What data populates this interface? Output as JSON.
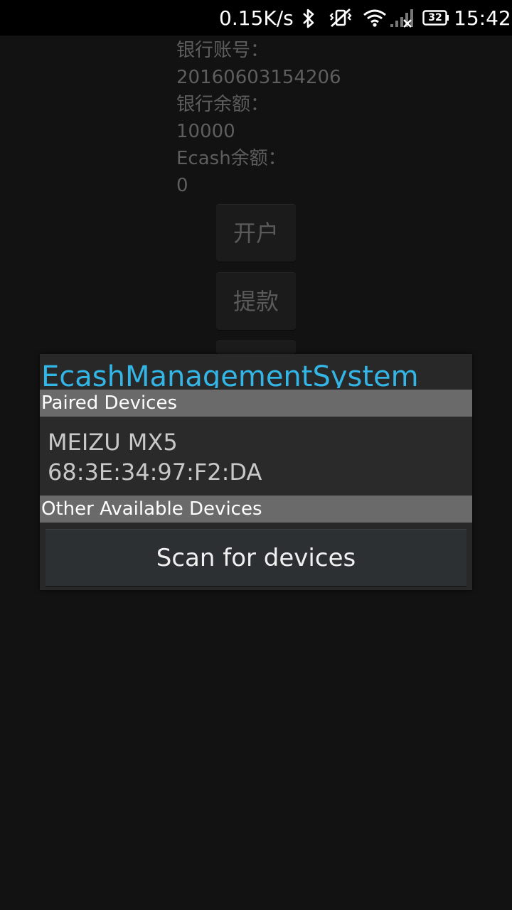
{
  "status_bar": {
    "net_speed": "0.15K/s",
    "battery_level": "32",
    "time": "15:42",
    "icons": [
      "bluetooth-icon",
      "vibrate-silent-icon",
      "wifi-icon",
      "signal-icon",
      "battery-icon"
    ]
  },
  "background": {
    "bank_account_label": "银行账号：",
    "bank_account_value": "20160603154206",
    "bank_balance_label": "银行余额：",
    "bank_balance_value": "10000",
    "ecash_balance_label": "Ecash余额：",
    "ecash_balance_value": "0",
    "open_account_button": "开户",
    "withdraw_button": "提款"
  },
  "dialog": {
    "title": "EcashManagementSystem",
    "paired_header": "Paired Devices",
    "paired_devices": [
      {
        "name": "MEIZU MX5",
        "address": "68:3E:34:97:F2:DA"
      }
    ],
    "other_header": "Other Available Devices",
    "scan_button": "Scan for devices"
  },
  "colors": {
    "accent": "#33b5e5",
    "background": "#121212",
    "dialog": "#282828",
    "section_header": "#6a6a6a"
  }
}
